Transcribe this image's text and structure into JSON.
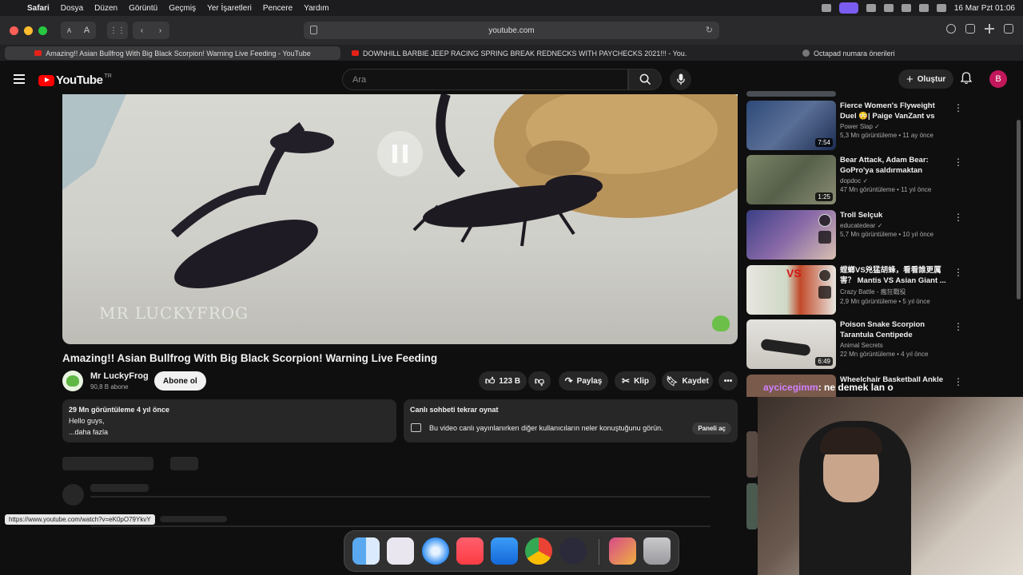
{
  "menubar": {
    "apple": "",
    "items": [
      "Safari",
      "Dosya",
      "Düzen",
      "Görüntü",
      "Geçmiş",
      "Yer İşaretleri",
      "Pencere",
      "Yardım"
    ],
    "clock": "16 Mar Pzt  01:06"
  },
  "browser": {
    "reader_small": "A",
    "reader_large": "A",
    "url": "youtube.com",
    "tabs": [
      {
        "label": "Amazing!! Asian Bullfrog With Big Black Scorpion! Warning Live Feeding - YouTube"
      },
      {
        "label": "DOWNHILL BARBIE JEEP RACING SPRING BREAK REDNECKS WITH PAYCHECKS 2021!!! - You..."
      },
      {
        "label": "Octapad numara önerileri"
      }
    ]
  },
  "yt": {
    "logo": "YouTube",
    "country": "TR",
    "search_placeholder": "Ara",
    "create_label": "Oluştur",
    "avatar_letter": "B"
  },
  "video": {
    "watermark": "MR LUCKYFROG",
    "title": "Amazing!! Asian Bullfrog With Big Black Scorpion! Warning Live Feeding",
    "channel": "Mr LuckyFrog",
    "subs": "90,8 B abone",
    "subscribe": "Abone ol",
    "likes": "123 B",
    "share": "Paylaş",
    "clip": "Klip",
    "save": "Kaydet",
    "desc_meta": "29 Mn görüntüleme  4 yıl önce",
    "desc_line": "Hello guys,",
    "desc_more": "...daha fazla"
  },
  "chat_replay": {
    "title": "Canlı sohbeti tekrar oynat",
    "text": "Bu video canlı yayınlanırken diğer kullanıcıların neler konuştuğunu görün.",
    "button": "Paneli aç"
  },
  "recommendations": [
    {
      "title": "Fierce Women's Flyweight Duel 😳| Paige VanZant vs Mikael-...",
      "channel": "Power Slap ✓",
      "meta": "5,3 Mn görüntüleme • 11 ay önce",
      "duration": "7:54",
      "color": "#3e5c8a"
    },
    {
      "title": "Bear Attack, Adam Bear: GoPro'ya saldırmaktan kaçma...",
      "channel": "dopdoc ✓",
      "meta": "47 Mn görüntüleme • 11 yıl önce",
      "duration": "1:25",
      "color": "#6a7357"
    },
    {
      "title": "Troll Selçuk",
      "channel": "educatedear ✓",
      "meta": "5,7 Mn görüntüleme • 10 yıl önce",
      "duration": "",
      "color": "#4a4f8a"
    },
    {
      "title": "螳螂VS兇猛胡蜂，看看誰更厲害？ Mantis VS Asian Giant ...",
      "channel": "Crazy Battle - 瘋狂戰役",
      "meta": "2,9 Mn görüntüleme • 5 yıl önce",
      "duration": "",
      "color": "#b8b0a6"
    },
    {
      "title": "Poison Snake Scorpion Tarantula Centipede",
      "channel": "Animal Secrets",
      "meta": "22 Mn görüntüleme • 4 yıl önce",
      "duration": "6:49",
      "color": "#d9d6d0"
    },
    {
      "title": "Wheelchair Basketball Ankle",
      "channel": "",
      "meta": "",
      "duration": "",
      "color": "#8a6b5a"
    }
  ],
  "overlay": {
    "chat_user": "aycicegimm",
    "chat_msg": ": ne demek lan o"
  },
  "status_url": "https://www.youtube.com/watch?v=eK0pO79YkvY"
}
